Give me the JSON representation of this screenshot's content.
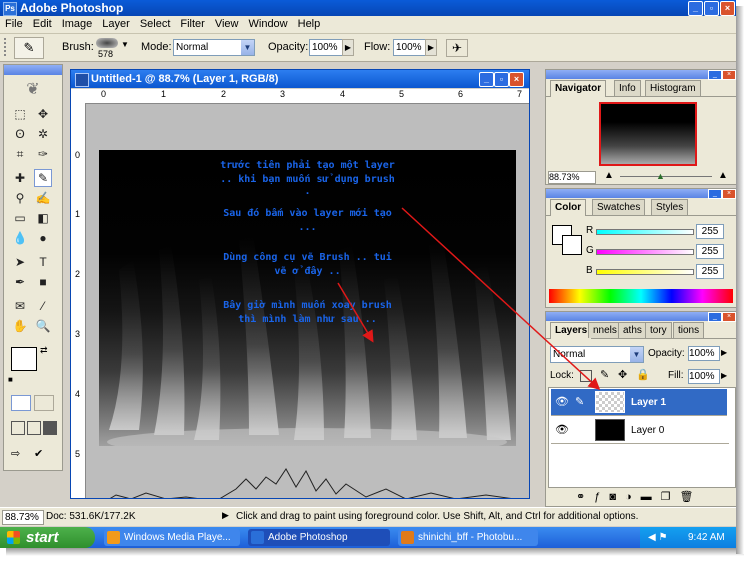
{
  "app": {
    "title": "Adobe Photoshop"
  },
  "menu": [
    "File",
    "Edit",
    "Image",
    "Layer",
    "Select",
    "Filter",
    "View",
    "Window",
    "Help"
  ],
  "options": {
    "brush_label": "Brush:",
    "brush_size": "578",
    "mode_label": "Mode:",
    "mode_value": "Normal",
    "opacity_label": "Opacity:",
    "opacity_value": "100%",
    "flow_label": "Flow:",
    "flow_value": "100%"
  },
  "document": {
    "title": "Untitled-1 @ 88.7% (Layer 1, RGB/8)",
    "ruler_h": [
      "0",
      "1",
      "2",
      "3",
      "4",
      "5",
      "6",
      "7"
    ],
    "ruler_v": [
      "0",
      "1",
      "2",
      "3",
      "4",
      "5"
    ],
    "notes": [
      "trước tiên phải tạo một layer",
      ".. khi bạn muốn sử dụng brush",
      ".",
      "Sau đó bấm vào layer mới tạo",
      "...",
      "Dùng công cụ vẽ Brush .. tui",
      "vẽ ở đây ..",
      "Bây giờ mình muốn xoay brush",
      "thì mình làm như sau .."
    ]
  },
  "navigator": {
    "tabs": [
      "Navigator",
      "Info",
      "Histogram"
    ],
    "zoom": "88.73%"
  },
  "color_panel": {
    "tabs": [
      "Color",
      "Swatches",
      "Styles"
    ],
    "channels": [
      {
        "label": "R",
        "value": "255"
      },
      {
        "label": "G",
        "value": "255"
      },
      {
        "label": "B",
        "value": "255"
      }
    ]
  },
  "layers_panel": {
    "tabs": [
      "Layers",
      "nnels",
      "aths",
      "tory",
      "tions"
    ],
    "blend_mode": "Normal",
    "opacity_label": "Opacity:",
    "opacity_value": "100%",
    "lock_label": "Lock:",
    "fill_label": "Fill:",
    "fill_value": "100%",
    "layers": [
      {
        "name": "Layer 1",
        "selected": true
      },
      {
        "name": "Layer 0",
        "selected": false
      }
    ]
  },
  "status": {
    "zoom": "88.73%",
    "doc": "Doc: 531.6K/177.2K",
    "hint": "Click and drag to paint using foreground color.  Use Shift, Alt, and Ctrl for additional options."
  },
  "taskbar": {
    "start": "start",
    "tasks": [
      "Windows Media Playe...",
      "Adobe Photoshop",
      "shinichi_bff - Photobu..."
    ],
    "clock": "9:42 AM"
  },
  "colors": {
    "xp_blue": "#0746b4",
    "note_blue": "#1a64e8",
    "arrow_red": "#e01818",
    "selection": "#316ac5"
  }
}
